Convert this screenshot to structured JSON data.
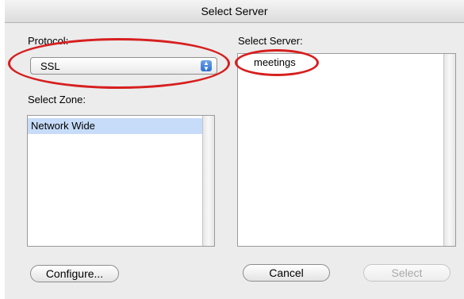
{
  "window": {
    "title": "Select Server"
  },
  "protocol": {
    "label": "Protocol:",
    "value": "SSL"
  },
  "zone": {
    "label": "Select Zone:",
    "items": [
      "Network Wide"
    ],
    "selected": "Network Wide"
  },
  "server": {
    "label": "Select Server:",
    "items": [
      "meetings"
    ]
  },
  "buttons": {
    "configure": "Configure...",
    "cancel": "Cancel",
    "select": "Select"
  },
  "annotations": {
    "color": "#d71f1f"
  }
}
